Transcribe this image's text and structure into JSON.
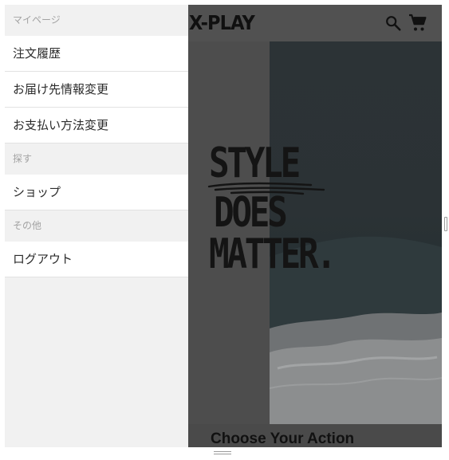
{
  "drawer": {
    "sections": [
      {
        "header": "マイページ",
        "items": [
          "注文履歴",
          "お届け先情報変更",
          "お支払い方法変更"
        ]
      },
      {
        "header": "探す",
        "items": [
          "ショップ"
        ]
      },
      {
        "header": "その他",
        "items": [
          "ログアウト"
        ]
      }
    ],
    "active_item": "注文履歴",
    "active_color": "#d41d2c"
  },
  "page": {
    "logo": "X-PLAY",
    "hero_slogan": [
      "STYLE",
      "DOES",
      "MATTER."
    ],
    "section_title": "Choose Your Action",
    "icons": [
      "search-icon",
      "cart-icon"
    ]
  }
}
